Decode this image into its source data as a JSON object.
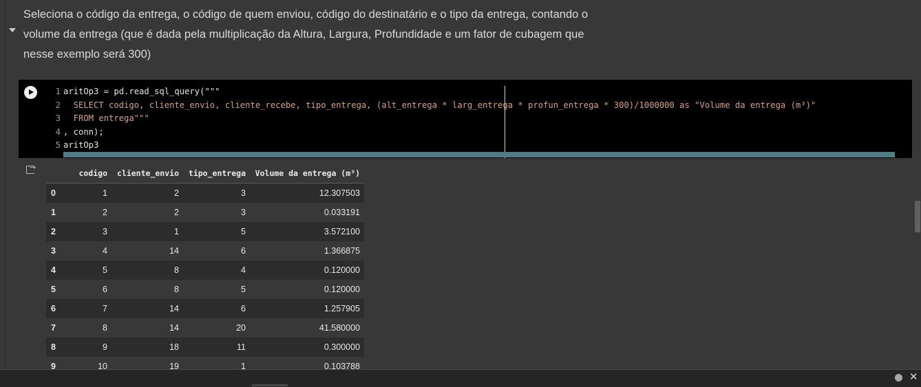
{
  "markdown": {
    "lines": [
      "Seleciona o código da entrega, o código de quem enviou, código do destinatário e o tipo da entrega, contando o",
      "volume da entrega (que é dada pela multiplicação da Altura, Largura, Profundidade e um fator de cubagem que",
      "nesse exemplo será 300)"
    ]
  },
  "code": {
    "lines": [
      {
        "num": "1",
        "text": "aritOp3 = pd.read_sql_query(\"\"\""
      },
      {
        "num": "2",
        "text": "  SELECT codigo, cliente_envio, cliente_recebe, tipo_entrega, (alt_entrega * larg_entrega * profun_entrega * 300)/1000000 as \"Volume da entrega (m³)\""
      },
      {
        "num": "3",
        "text": "  FROM entrega\"\"\""
      },
      {
        "num": "4",
        "text": ", conn);"
      },
      {
        "num": "5",
        "text": "aritOp3"
      }
    ]
  },
  "table": {
    "columns": [
      "codigo",
      "cliente_envio",
      "tipo_entrega",
      "Volume da entrega (m³)"
    ],
    "rows": [
      {
        "index": "0",
        "codigo": "1",
        "cliente_envio": "2",
        "tipo_entrega": "3",
        "volume": "12.307503"
      },
      {
        "index": "1",
        "codigo": "2",
        "cliente_envio": "2",
        "tipo_entrega": "3",
        "volume": "0.033191"
      },
      {
        "index": "2",
        "codigo": "3",
        "cliente_envio": "1",
        "tipo_entrega": "5",
        "volume": "3.572100"
      },
      {
        "index": "3",
        "codigo": "4",
        "cliente_envio": "14",
        "tipo_entrega": "6",
        "volume": "1.366875"
      },
      {
        "index": "4",
        "codigo": "5",
        "cliente_envio": "8",
        "tipo_entrega": "4",
        "volume": "0.120000"
      },
      {
        "index": "5",
        "codigo": "6",
        "cliente_envio": "8",
        "tipo_entrega": "5",
        "volume": "0.120000"
      },
      {
        "index": "6",
        "codigo": "7",
        "cliente_envio": "14",
        "tipo_entrega": "6",
        "volume": "1.257905"
      },
      {
        "index": "7",
        "codigo": "8",
        "cliente_envio": "14",
        "tipo_entrega": "20",
        "volume": "41.580000"
      },
      {
        "index": "8",
        "codigo": "9",
        "cliente_envio": "18",
        "tipo_entrega": "11",
        "volume": "0.300000"
      },
      {
        "index": "9",
        "codigo": "10",
        "cliente_envio": "19",
        "tipo_entrega": "1",
        "volume": "0.103788"
      }
    ]
  },
  "icons": {
    "run": "play-icon",
    "output": "output-icon",
    "collapse": "chevron-down-icon",
    "close": "close-icon"
  },
  "colors": {
    "accent_scrollbar": "#4f7c87",
    "string": "#d9a17a",
    "background": "#383838"
  }
}
